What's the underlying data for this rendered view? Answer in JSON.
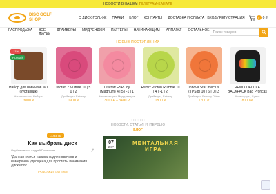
{
  "topbar": {
    "text": "НОВОСТИ В НАШЕМ",
    "highlight": "ТЕЛЕГРАМ-КАНАЛЕ"
  },
  "logo": {
    "line1": "DISC GOLF",
    "line2": "SHOP"
  },
  "mainnav": [
    "О ДИСК-ГОЛЬФЕ",
    "ПАРКИ",
    "БЛОГ",
    "КОНТАКТЫ",
    "ДОСТАВКА И ОПЛАТА"
  ],
  "account": {
    "login": "ВХОД / РЕГИСТРАЦИЯ",
    "cart_count": "0",
    "cart_total": "0 ₽"
  },
  "catnav": [
    "РАСПРОДАЖА",
    "ВСЕ ДИСКИ",
    "ДРАЙВЕРЫ",
    "МИДРЕНДЖИ",
    "ПАТТЕРЫ",
    "НАЧИНАЮЩИМ",
    "АППАРАТ",
    "ОСТАЛЬНОЕ"
  ],
  "search": {
    "placeholder": "Поиск товаров"
  },
  "new_section": "НОВЫЕ ПОСТУПЛЕНИЯ",
  "products": [
    {
      "title": "Набор для новичков №1 (кустарник)",
      "category": "Начинающим, Наборы",
      "price": "3000 ₽",
      "badge1": "-11%",
      "badge2": "НОВЫЙ"
    },
    {
      "title": "Discraft Z Vulture 10 | 5 | 0 | 2",
      "category": "Драйверы, Fairway",
      "price": "1900 ₽"
    },
    {
      "title": "Discraft ESP Joy (Magnum) 4 | 5 | -1 | 1",
      "category": "Начинающим, Миддленджи",
      "price": "3000 ₽ – 3400 ₽"
    },
    {
      "title": "Remix Proton Rumble 10 | 4 | -1 | 2",
      "category": "Драйверы, Fairway",
      "price": "1800 ₽"
    },
    {
      "title": "Innova Star Invictus (TPSig) 10 | 6 | 0 | 3",
      "category": "Драйверы, Fairway Driver",
      "price": "1700 ₽"
    },
    {
      "title": "REMIX DELUXE BACKPACK Bag Proncas",
      "category": "Аксессуары, Сумки",
      "price": "8000 ₽"
    }
  ],
  "dots": "• • • • • • • •",
  "blog_heading": "НОВОСТИ, СТАТЬИ, ИНТЕРВЬЮ",
  "blog_label": "БЛОГ",
  "blog_post": {
    "label": "СОВЕТЫ",
    "title": "Как выбрать диск",
    "author": "Опубликовано: Андрей Поклонцев",
    "excerpt": "\"Данная статья написана для новичков и намеренно упрощена для простоты понимания. Диски пок...",
    "more": "ПРОДОЛЖИТЬ ЧТЕНИЕ"
  },
  "blog_image": {
    "day": "07",
    "month": "АПР",
    "headline1": "МЕНТАЛЬНАЯ",
    "headline2": "ИГРА"
  },
  "colors": {
    "accent": "#f2a516",
    "topbar": "#f7e93a"
  }
}
